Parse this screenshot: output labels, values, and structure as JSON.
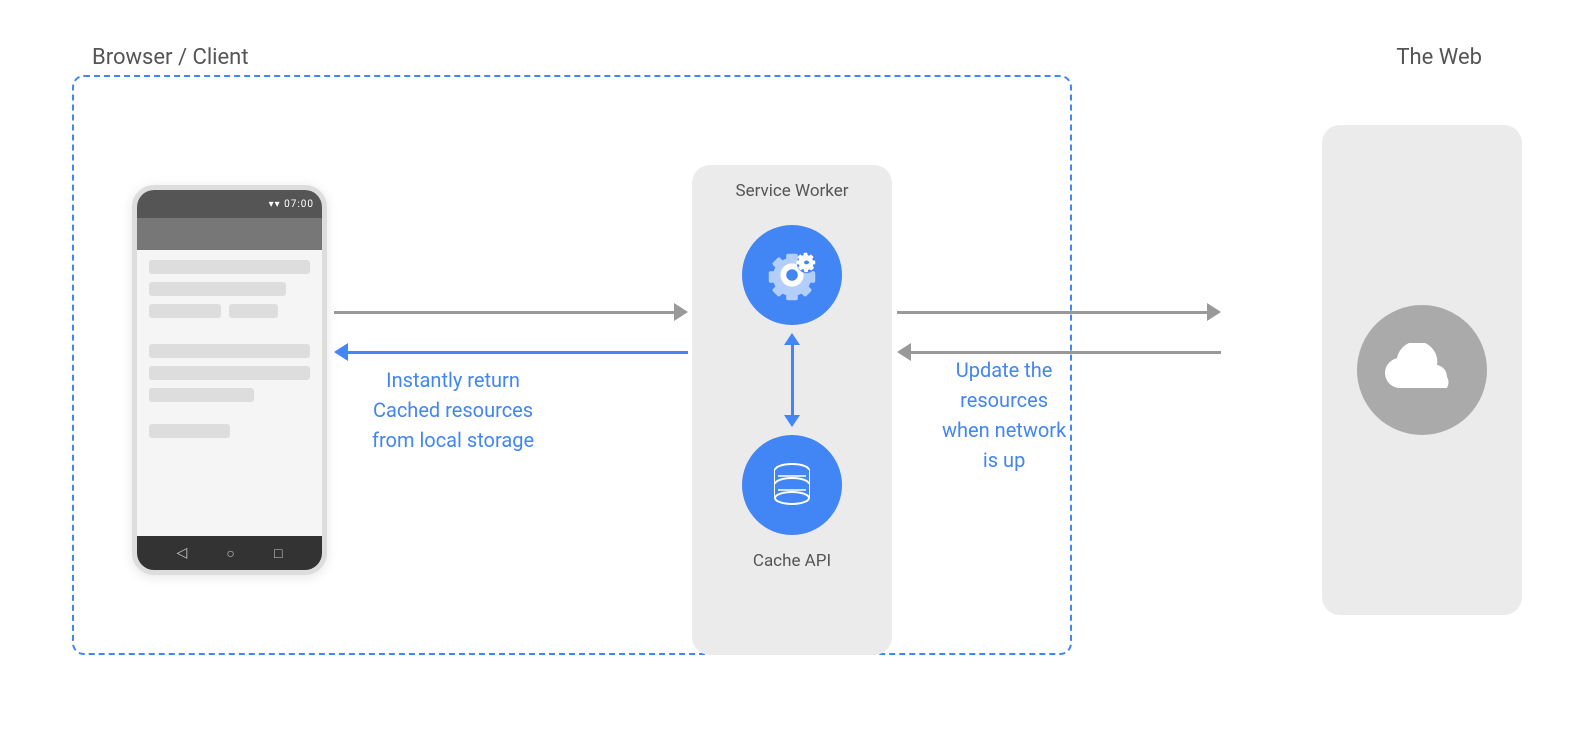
{
  "labels": {
    "browser_client": "Browser / Client",
    "the_web": "The Web",
    "service_worker": "Service Worker",
    "cache_api": "Cache API",
    "instantly_return": "Instantly return",
    "cached_resources": "Cached resources",
    "from_local_storage": "from local storage",
    "update_the": "Update the",
    "resources": "resources",
    "when_network": "when network",
    "is_up": "is up"
  },
  "colors": {
    "blue": "#4285f4",
    "gray_arrow": "#999999",
    "box_bg": "#ebebeb",
    "dashed_border": "#4285f4"
  }
}
